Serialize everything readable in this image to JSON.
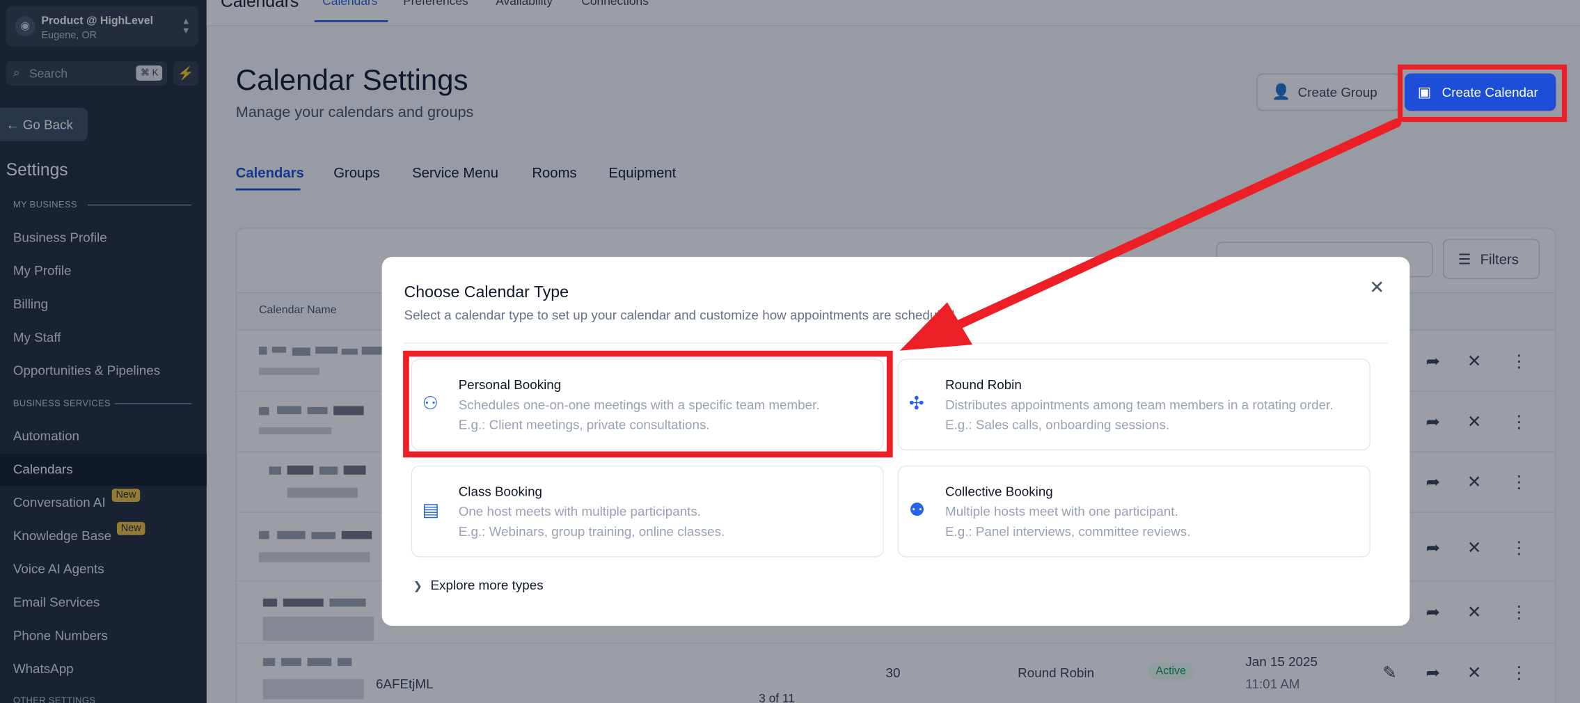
{
  "sidebar": {
    "location": {
      "name": "Product @ HighLevel",
      "city": "Eugene, OR",
      "icon": "user-circle-icon"
    },
    "search": {
      "placeholder": "Search",
      "shortcut": "⌘ K"
    },
    "go_back": "Go Back",
    "title": "Settings",
    "sections": [
      "MY BUSINESS",
      "BUSINESS SERVICES",
      "OTHER SETTINGS"
    ],
    "my_business": [
      "Business Profile",
      "My Profile",
      "Billing",
      "My Staff",
      "Opportunities & Pipelines"
    ],
    "business_services": [
      "Automation",
      "Calendars",
      "Conversation AI",
      "Knowledge Base",
      "Voice AI Agents",
      "Email Services",
      "Phone Numbers",
      "WhatsApp"
    ],
    "active_item": "Calendars",
    "badges": {
      "conversation_ai": "New",
      "knowledge_base": "New"
    }
  },
  "topbar": {
    "app_title": "Calendars",
    "tabs": [
      "Calendars",
      "Preferences",
      "Availability",
      "Connections"
    ],
    "active_tab": "Calendars"
  },
  "page": {
    "title": "Calendar Settings",
    "subtitle": "Manage your calendars and groups",
    "create_group": "Create Group",
    "create_calendar": "Create Calendar",
    "tabs": [
      "Calendars",
      "Groups",
      "Service Menu",
      "Rooms",
      "Equipment"
    ],
    "active_tab": "Calendars",
    "filters": "Filters",
    "table_header": "Calendar Name",
    "last_row": {
      "id": "6AFEtjML",
      "duration": "30",
      "type": "Round Robin",
      "status": "Active",
      "date": "Jan 15 2025",
      "time": "11:01 AM"
    },
    "pager": "3 of 11"
  },
  "modal": {
    "title": "Choose Calendar Type",
    "subtitle": "Select a calendar type to set up your calendar and customize how appointments are scheduled.",
    "cards": [
      {
        "name": "Personal Booking",
        "desc": "Schedules one-on-one meetings with a specific team member.",
        "example": "E.g.: Client meetings, private consultations.",
        "icon": "personal-booking-icon"
      },
      {
        "name": "Round Robin",
        "desc": "Distributes appointments among team members in a rotating order.",
        "example": "E.g.: Sales calls, onboarding sessions.",
        "icon": "round-robin-icon"
      },
      {
        "name": "Class Booking",
        "desc": "One host meets with multiple participants.",
        "example": "E.g.: Webinars, group training, online classes.",
        "icon": "class-booking-icon"
      },
      {
        "name": "Collective Booking",
        "desc": "Multiple hosts meet with one participant.",
        "example": "E.g.: Panel interviews, committee reviews.",
        "icon": "collective-booking-icon"
      }
    ],
    "explore_more": "Explore more types"
  },
  "annotation": {
    "highlight_color": "#ec1f27"
  }
}
